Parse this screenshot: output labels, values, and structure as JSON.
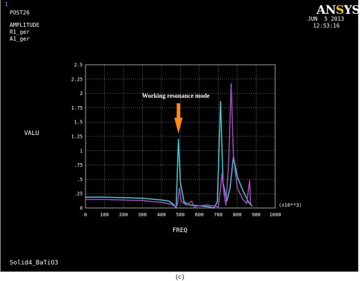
{
  "header": {
    "window_number": "1",
    "post_label": "POST26",
    "amplitude_label": "AMPLITUDE",
    "legend": [
      {
        "label": "R1_ger",
        "color": "#3fd6e3"
      },
      {
        "label": "A1_ger",
        "color": "#b04ac8"
      }
    ],
    "date": "JUN  5 2013",
    "time": "12:53:16",
    "logo": {
      "main": "AN",
      "accent": "S",
      "rest": "YS"
    }
  },
  "footer": {
    "model_name": "Solid4_BaTiO3",
    "caption": "(c)"
  },
  "colors": {
    "background": "#000000",
    "grid": "#ffffff",
    "annotation_arrow": "#ff8c1a"
  },
  "chart_data": {
    "type": "line",
    "xlabel": "FREQ",
    "ylabel": "VALU",
    "x_multiplier_label": "(x10**3)",
    "xlim": [
      0,
      1000
    ],
    "ylim": [
      0,
      2.5
    ],
    "x_ticks": [
      0,
      100,
      200,
      300,
      400,
      500,
      600,
      700,
      800,
      900,
      1000
    ],
    "x_tick_labels": [
      "0",
      "100",
      "200",
      "300",
      "400",
      "500",
      "600",
      "700",
      "800",
      "900",
      "1000"
    ],
    "y_ticks": [
      0,
      0.25,
      0.5,
      0.75,
      1,
      1.25,
      1.5,
      1.75,
      2,
      2.25,
      2.5
    ],
    "y_tick_labels": [
      "0",
      ".25",
      ".5",
      ".75",
      "1",
      "1.25",
      "1.5",
      "1.75",
      "2",
      "2.25",
      "2.5"
    ],
    "grid": true,
    "annotation": {
      "text": "Working resonance mode",
      "x": 490,
      "y": 1.2
    },
    "series": [
      {
        "name": "R1_ger",
        "color": "#3fd6e3",
        "points": [
          [
            0,
            0.19
          ],
          [
            100,
            0.19
          ],
          [
            200,
            0.18
          ],
          [
            300,
            0.17
          ],
          [
            400,
            0.14
          ],
          [
            440,
            0.12
          ],
          [
            465,
            0.06
          ],
          [
            478,
            0.0
          ],
          [
            490,
            1.2
          ],
          [
            500,
            0.45
          ],
          [
            520,
            0.1
          ],
          [
            550,
            0.05
          ],
          [
            600,
            0.04
          ],
          [
            650,
            0.02
          ],
          [
            675,
            0.0
          ],
          [
            695,
            0.1
          ],
          [
            712,
            1.86
          ],
          [
            725,
            0.45
          ],
          [
            745,
            0.12
          ],
          [
            762,
            0.35
          ],
          [
            780,
            0.9
          ],
          [
            800,
            0.55
          ],
          [
            830,
            0.3
          ],
          [
            860,
            0.1
          ],
          [
            880,
            0.03
          ]
        ]
      },
      {
        "name": "A1_ger",
        "color": "#b04ac8",
        "points": [
          [
            0,
            0.15
          ],
          [
            100,
            0.15
          ],
          [
            200,
            0.14
          ],
          [
            300,
            0.13
          ],
          [
            400,
            0.1
          ],
          [
            450,
            0.07
          ],
          [
            475,
            0.02
          ],
          [
            485,
            0.06
          ],
          [
            495,
            0.35
          ],
          [
            505,
            0.12
          ],
          [
            530,
            0.05
          ],
          [
            560,
            0.12
          ],
          [
            575,
            0.0
          ],
          [
            585,
            0.03
          ],
          [
            600,
            0.04
          ],
          [
            640,
            0.05
          ],
          [
            670,
            0.04
          ],
          [
            700,
            0.02
          ],
          [
            712,
            0.35
          ],
          [
            720,
            0.6
          ],
          [
            730,
            0.25
          ],
          [
            740,
            0.05
          ],
          [
            755,
            0.8
          ],
          [
            768,
            2.17
          ],
          [
            780,
            0.9
          ],
          [
            800,
            0.35
          ],
          [
            830,
            0.15
          ],
          [
            850,
            0.08
          ],
          [
            865,
            0.48
          ],
          [
            870,
            0.08
          ],
          [
            880,
            0.03
          ]
        ]
      }
    ]
  }
}
